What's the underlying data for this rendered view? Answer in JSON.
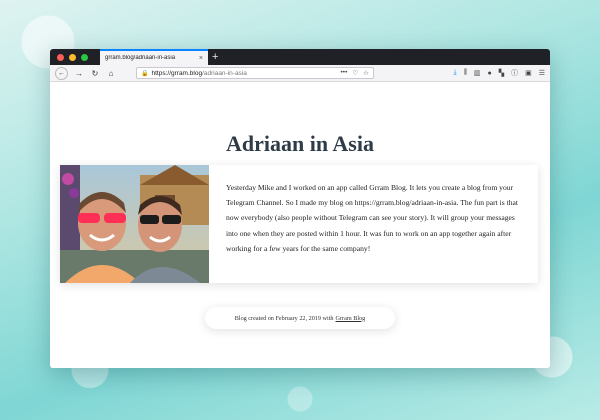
{
  "browser": {
    "tab_title": "grram.blog/adriaan-in-asia",
    "tab_close": "×",
    "new_tab": "+",
    "url_base": "https://grram.blog",
    "url_path": "/adriaan-in-asia"
  },
  "page": {
    "title": "Adriaan in Asia",
    "post_text": "Yesterday Mike and I worked on an app called Grram Blog. It lets you create a blog from your Telegram Channel. So I made my blog on https://grram.blog/adriaan-in-asia. The fun part is that now everybody (also people without Telegram can see your story). It will group your messages into one when they are posted within 1 hour. It was fun to work on an app together again after working for a few years for the same company!",
    "footer_prefix": "Blog created on February 22, 2019 with",
    "footer_link": "Grram Blog"
  },
  "colors": {
    "accent": "#0a84ff",
    "title": "#2f3b47",
    "tab_bar": "#1f2127"
  }
}
